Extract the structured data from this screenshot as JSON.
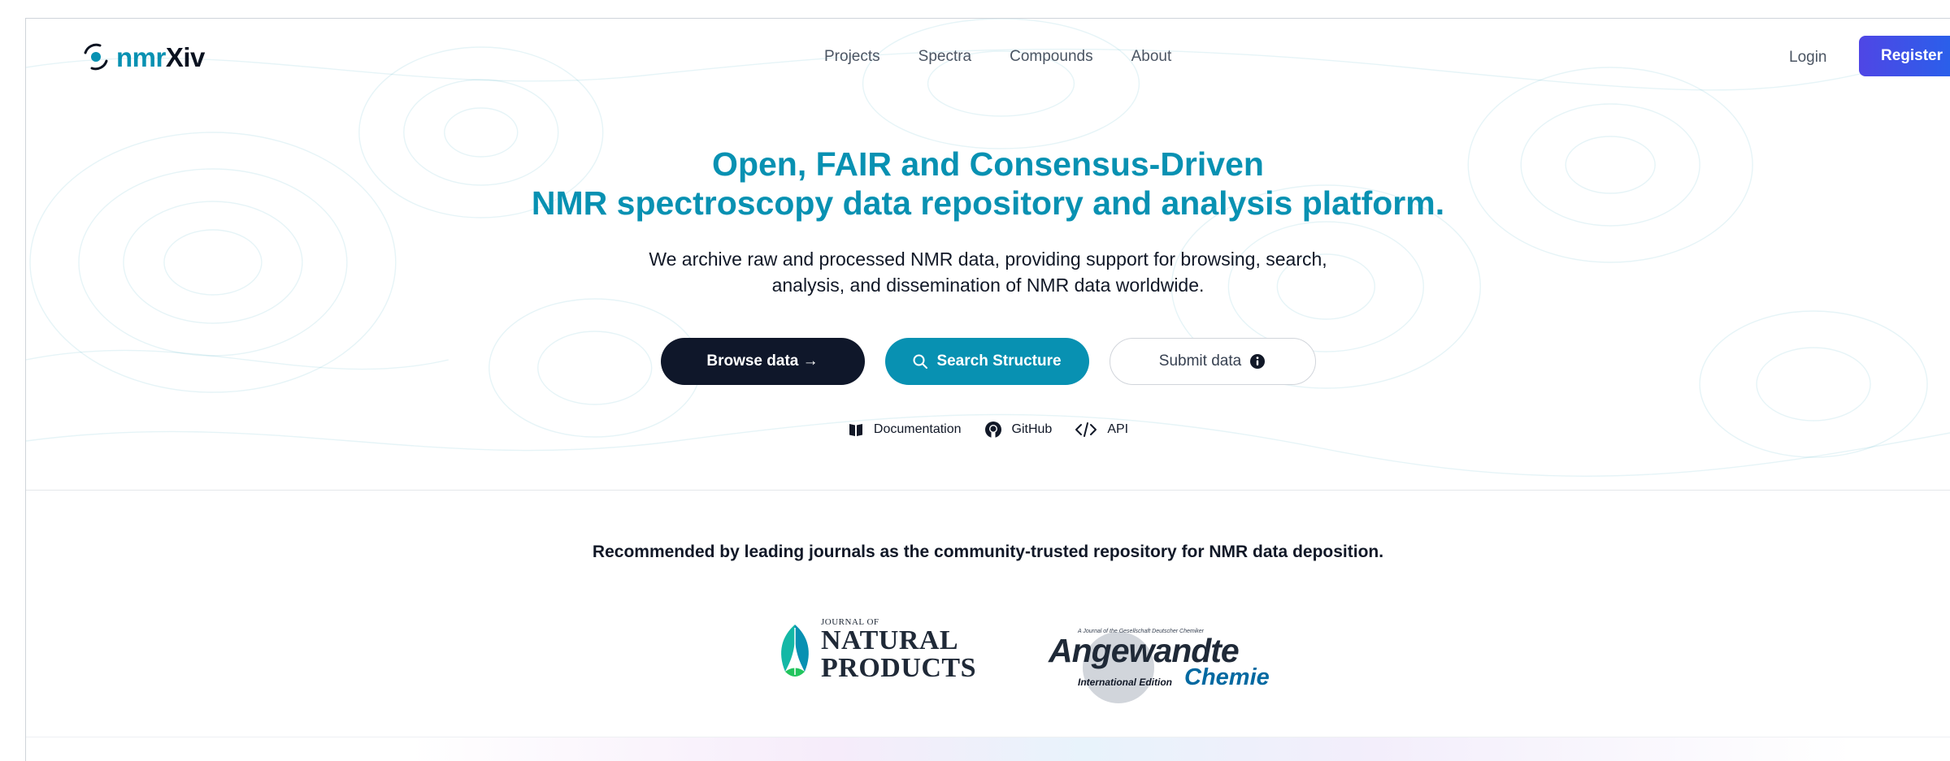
{
  "header": {
    "logo": {
      "prefix": "nmr",
      "suffix": "Xiv"
    },
    "nav": [
      "Projects",
      "Spectra",
      "Compounds",
      "About"
    ],
    "login": "Login",
    "register": "Register"
  },
  "hero": {
    "title_line1": "Open, FAIR and Consensus-Driven",
    "title_line2": "NMR spectroscopy data repository and analysis platform.",
    "subtitle_line1": "We archive raw and processed NMR data, providing support for browsing, search,",
    "subtitle_line2": "analysis, and dissemination of NMR data worldwide.",
    "buttons": {
      "browse": "Browse data →",
      "search": "Search Structure",
      "submit": "Submit data"
    },
    "links": {
      "documentation": "Documentation",
      "github": "GitHub",
      "api": "API"
    }
  },
  "journals": {
    "heading": "Recommended by leading journals as the community-trusted repository for NMR data deposition.",
    "jnp": {
      "small": "JOURNAL OF",
      "line1": "NATURAL",
      "line2": "PRODUCTS"
    },
    "angewandte": {
      "tagline": "A Journal of the Gesellschaft Deutscher Chemiker",
      "word": "Angewandte",
      "edition": "International Edition",
      "chemie": "Chemie"
    }
  },
  "colors": {
    "accent": "#0891b2",
    "dark": "#0f172a",
    "register": "#4f46e5"
  }
}
